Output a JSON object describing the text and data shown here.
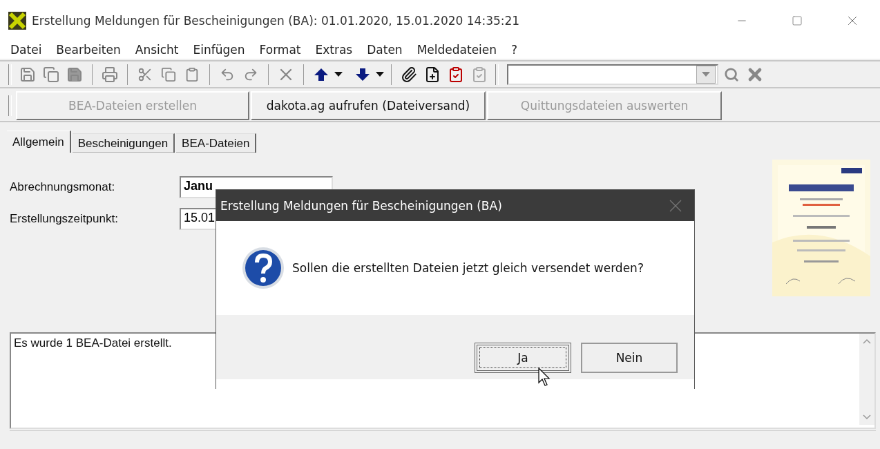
{
  "window": {
    "title": "Erstellung Meldungen für Bescheinigungen (BA): 01.01.2020, 15.01.2020 14:35:21"
  },
  "menu": [
    "Datei",
    "Bearbeiten",
    "Ansicht",
    "Einfügen",
    "Format",
    "Extras",
    "Daten",
    "Meldedateien",
    "?"
  ],
  "action_buttons": [
    {
      "label": "BEA-Dateien erstellen",
      "disabled": true
    },
    {
      "label": "dakota.ag aufrufen (Dateiversand)",
      "disabled": false
    },
    {
      "label": "Quittungsdateien auswerten",
      "disabled": true
    }
  ],
  "tabs": [
    {
      "label": "Allgemein",
      "selected": true
    },
    {
      "label": "Bescheinigungen",
      "selected": false
    },
    {
      "label": "BEA-Dateien",
      "selected": false
    }
  ],
  "fields": [
    {
      "label": "Abrechnungsmonat:",
      "value": "Janu",
      "bold": true
    },
    {
      "label": "Erstellungszeitpunkt:",
      "value": "15.01",
      "bold": false
    }
  ],
  "log": {
    "text": "Es wurde 1 BEA-Datei erstellt."
  },
  "dialog": {
    "title": "Erstellung Meldungen für Bescheinigungen (BA)",
    "message": "Sollen die erstellten Dateien jetzt gleich versendet werden?",
    "buttons": [
      {
        "label": "Ja",
        "default": true
      },
      {
        "label": "Nein",
        "default": false
      }
    ]
  }
}
